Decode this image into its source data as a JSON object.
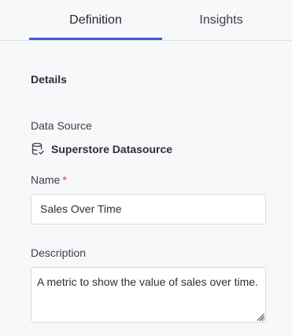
{
  "tabs": [
    {
      "label": "Definition",
      "active": true
    },
    {
      "label": "Insights",
      "active": false
    }
  ],
  "section_title": "Details",
  "data_source": {
    "label": "Data Source",
    "icon": "database-check-icon",
    "value": "Superstore Datasource"
  },
  "name_field": {
    "label": "Name",
    "required_marker": "*",
    "value": "Sales Over Time"
  },
  "description_field": {
    "label": "Description",
    "value": "A metric to show the value of sales over time."
  },
  "colors": {
    "accent": "#3f5fc9",
    "required": "#d0453a",
    "background": "#f7f8fa"
  }
}
